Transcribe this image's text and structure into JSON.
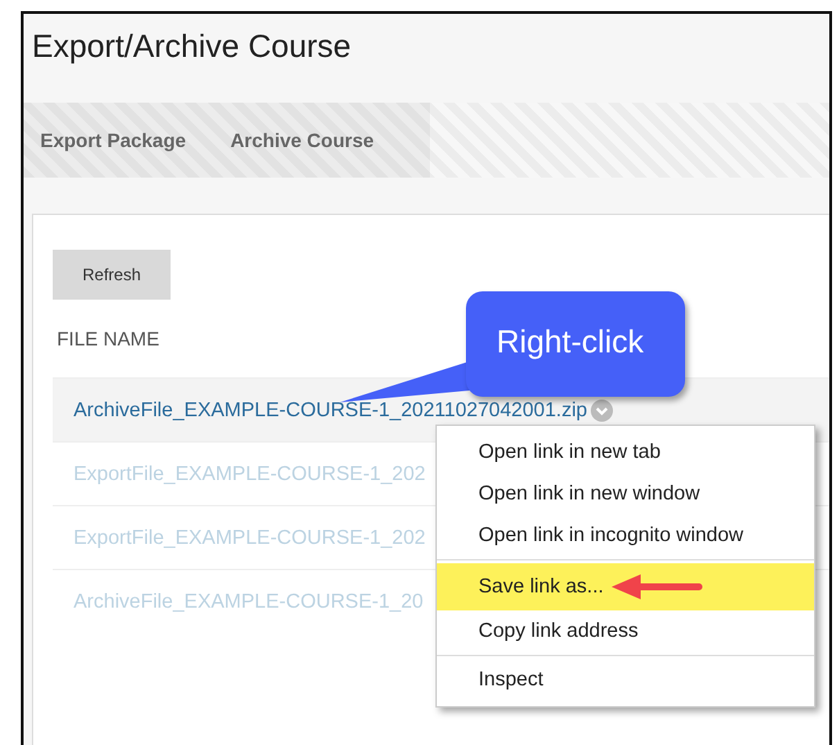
{
  "page": {
    "title": "Export/Archive Course"
  },
  "tabs": [
    {
      "label": "Export Package"
    },
    {
      "label": "Archive Course"
    }
  ],
  "refresh_button": {
    "label": "Refresh"
  },
  "table": {
    "columns": [
      "FILE NAME"
    ],
    "rows": [
      {
        "file_name": "ArchiveFile_EXAMPLE-COURSE-1_20211027042001.zip",
        "highlighted": true
      },
      {
        "file_name": "ExportFile_EXAMPLE-COURSE-1_202",
        "highlighted": false
      },
      {
        "file_name": "ExportFile_EXAMPLE-COURSE-1_202",
        "highlighted": false
      },
      {
        "file_name": "ArchiveFile_EXAMPLE-COURSE-1_20",
        "highlighted": false
      }
    ]
  },
  "callout": {
    "text": "Right-click"
  },
  "context_menu": {
    "groups": [
      [
        {
          "label": "Open link in new tab",
          "highlighted": false
        },
        {
          "label": "Open link in new window",
          "highlighted": false
        },
        {
          "label": "Open link in incognito window",
          "highlighted": false
        }
      ],
      [
        {
          "label": "Save link as...",
          "highlighted": true
        },
        {
          "label": "Copy link address",
          "highlighted": false
        }
      ],
      [
        {
          "label": "Inspect",
          "highlighted": false
        }
      ]
    ]
  }
}
